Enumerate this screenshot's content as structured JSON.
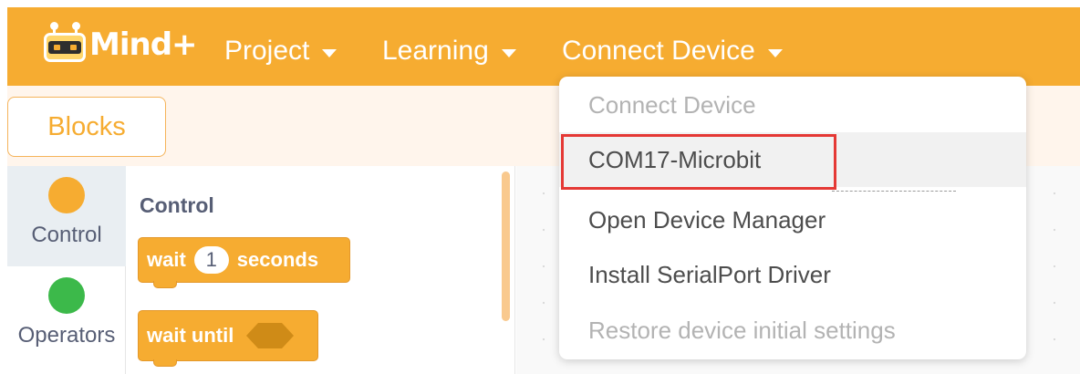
{
  "app": {
    "logo_text": "Mind+",
    "menu": [
      {
        "label": "Project"
      },
      {
        "label": "Learning"
      },
      {
        "label": "Connect Device"
      }
    ]
  },
  "toolbar": {
    "active_tab": "Blocks"
  },
  "categories": [
    {
      "label": "Control",
      "color": "#f6ac31",
      "selected": true
    },
    {
      "label": "Operators",
      "color": "#3cb94a",
      "selected": false
    }
  ],
  "palette": {
    "section_title": "Control",
    "blocks": [
      {
        "prefix": "wait",
        "input_value": "1",
        "suffix": "seconds"
      },
      {
        "prefix": "wait until"
      }
    ]
  },
  "dropdown": {
    "items": [
      {
        "label": "Connect Device",
        "disabled": true
      },
      {
        "label": "COM17-Microbit",
        "disabled": false,
        "highlighted": true
      },
      {
        "label": "Open Device Manager",
        "disabled": false
      },
      {
        "label": "Install SerialPort Driver",
        "disabled": false
      },
      {
        "label": "Restore device initial settings",
        "disabled": true
      }
    ]
  },
  "colors": {
    "brand": "#f6ac31",
    "highlight_border": "#e53935"
  }
}
